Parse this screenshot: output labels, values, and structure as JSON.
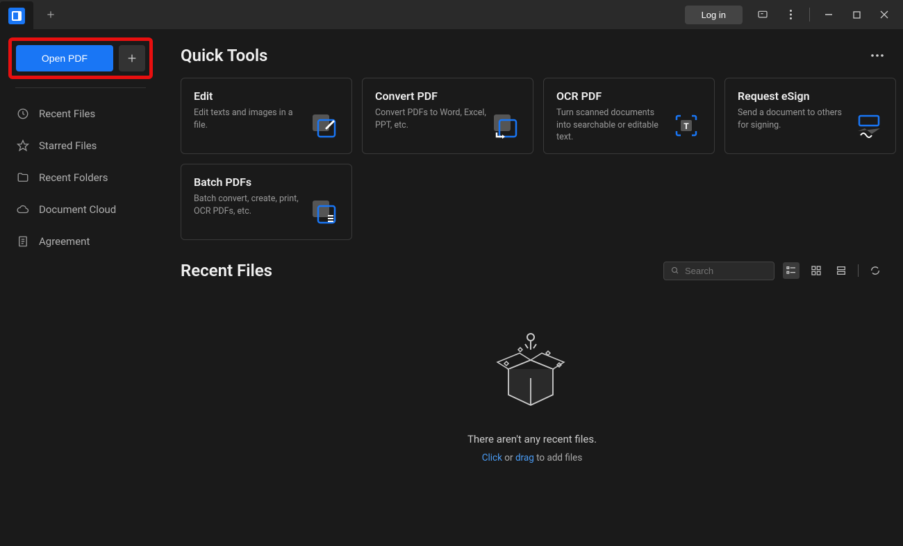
{
  "titlebar": {
    "login_label": "Log in"
  },
  "sidebar": {
    "open_pdf_label": "Open PDF",
    "items": [
      {
        "label": "Recent Files",
        "icon": "clock"
      },
      {
        "label": "Starred Files",
        "icon": "star"
      },
      {
        "label": "Recent Folders",
        "icon": "folder"
      },
      {
        "label": "Document Cloud",
        "icon": "cloud"
      },
      {
        "label": "Agreement",
        "icon": "doc"
      }
    ]
  },
  "quick_tools": {
    "title": "Quick Tools",
    "cards": [
      {
        "title": "Edit",
        "desc": "Edit texts and images in a file."
      },
      {
        "title": "Convert PDF",
        "desc": "Convert PDFs to Word, Excel, PPT, etc."
      },
      {
        "title": "OCR PDF",
        "desc": "Turn scanned documents into searchable or editable text."
      },
      {
        "title": "Request eSign",
        "desc": "Send a document to others for signing."
      },
      {
        "title": "Batch PDFs",
        "desc": "Batch convert, create, print, OCR PDFs, etc."
      }
    ]
  },
  "recent": {
    "title": "Recent Files",
    "search_placeholder": "Search",
    "empty_text": "There aren't any recent files.",
    "empty_hint_click": "Click",
    "empty_hint_or": " or ",
    "empty_hint_drag": "drag",
    "empty_hint_rest": " to add files"
  }
}
